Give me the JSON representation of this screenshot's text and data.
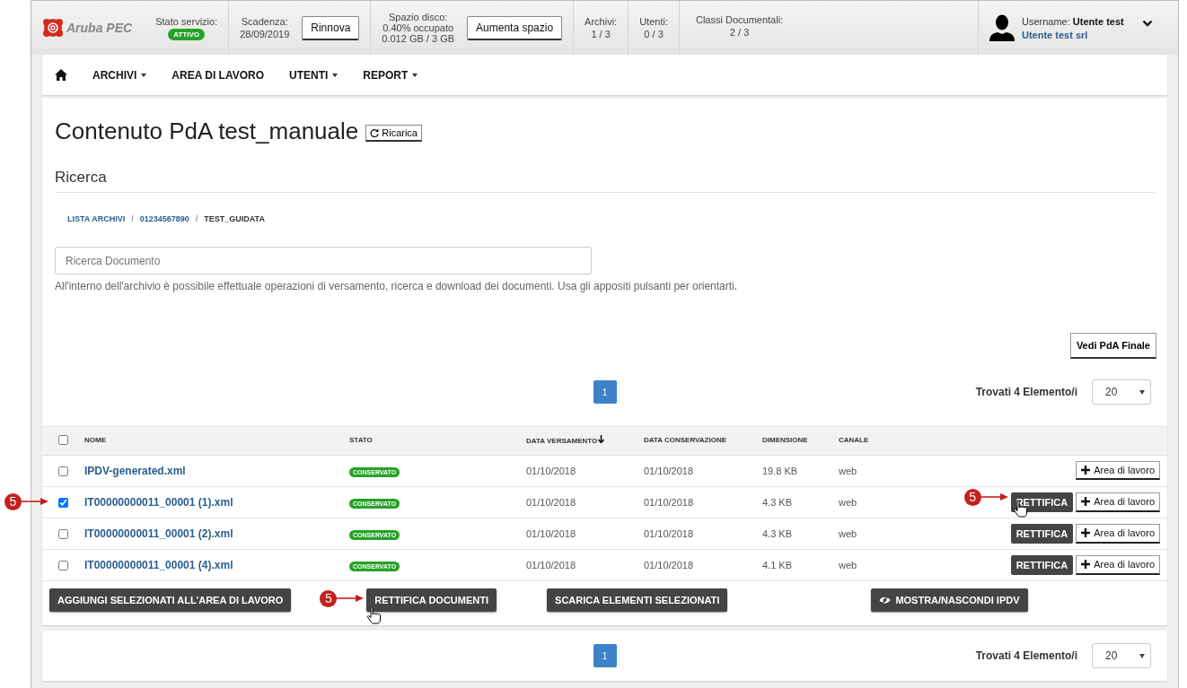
{
  "header": {
    "logo": "Aruba PEC",
    "status": {
      "label": "Stato servizio:",
      "badge": "ATTIVO"
    },
    "expiry": {
      "label": "Scadenza:",
      "value": "28/09/2019",
      "button": "Rinnova"
    },
    "disk": {
      "label": "Spazio disco:",
      "used": "0.40% occupato",
      "value": "0.012 GB / 3 GB",
      "button": "Aumenta spazio"
    },
    "counters": [
      {
        "label": "Archivi:",
        "value": "1 / 3"
      },
      {
        "label": "Utenti:",
        "value": "0 / 3"
      },
      {
        "label": "Classi Documentali:",
        "value": "2 / 3"
      }
    ],
    "user": {
      "label": "Username:",
      "name": "Utente test",
      "company": "Utente test srl"
    }
  },
  "nav": [
    {
      "label": "ARCHIVI",
      "dropdown": true
    },
    {
      "label": "AREA DI LAVORO",
      "dropdown": false
    },
    {
      "label": "UTENTI",
      "dropdown": true
    },
    {
      "label": "REPORT",
      "dropdown": true
    }
  ],
  "title": "Contenuto PdA test_manuale",
  "reload_button": "Ricarica",
  "section": "Ricerca",
  "breadcrumb": [
    {
      "label": "LISTA ARCHIVI",
      "link": true
    },
    {
      "separator": "/",
      "label": "01234567890",
      "link": true
    },
    {
      "separator": "/",
      "label": "TEST_GUIDATA",
      "link": false
    }
  ],
  "search": {
    "placeholder": "Ricerca Documento"
  },
  "help": "All'interno dell'archivio è possibile effettuale operazioni di versamento, ricerca e download dei documenti. Usa gli appositi pulsanti per orientarti.",
  "final_button": "Vedi PdA Finale",
  "pagination_top": {
    "pages": [
      {
        "label": "1",
        "selected": true
      }
    ],
    "found": "Trovati 4 Elemento/i",
    "page_size": "20"
  },
  "table": {
    "select_all_checked": false,
    "columns": [
      {
        "label": "NOME",
        "sorted": false
      },
      {
        "label": "STATO",
        "sorted": false
      },
      {
        "label": "DATA VERSAMENTO",
        "sorted": true
      },
      {
        "label": "DATA CONSERVAZIONE",
        "sorted": false
      },
      {
        "label": "DIMENSIONE",
        "sorted": false
      },
      {
        "label": "CANALE",
        "sorted": false
      }
    ],
    "rows": [
      {
        "checked": false,
        "name": "IPDV-generated.xml",
        "status": "CONSERVATO",
        "date_versamento": "01/10/2018",
        "date_conservazione": "01/10/2018",
        "size": "19.8 KB",
        "channel": "web",
        "add": "Area di lavoro"
      },
      {
        "checked": true,
        "name": "IT00000000011_00001 (1).xml",
        "status": "CONSERVATO",
        "date_versamento": "01/10/2018",
        "date_conservazione": "01/10/2018",
        "size": "4.3 KB",
        "channel": "web",
        "rettifica": "RETTIFICA",
        "add": "Area di lavoro",
        "checkbox_callout": "5",
        "rettifica_callout": "5"
      },
      {
        "checked": false,
        "name": "IT00000000011_00001 (2).xml",
        "status": "CONSERVATO",
        "date_versamento": "01/10/2018",
        "date_conservazione": "01/10/2018",
        "size": "4.3 KB",
        "channel": "web",
        "rettifica": "RETTIFICA",
        "add": "Area di lavoro"
      },
      {
        "checked": false,
        "name": "IT00000000011_00001 (4).xml",
        "status": "CONSERVATO",
        "date_versamento": "01/10/2018",
        "date_conservazione": "01/10/2018",
        "size": "4.1 KB",
        "channel": "web",
        "rettifica": "RETTIFICA",
        "add": "Area di lavoro"
      }
    ]
  },
  "actions": [
    {
      "label": "AGGIUNGI SELEZIONATI ALL'AREA DI LAVORO",
      "kind": "plain"
    },
    {
      "label": "RETTIFICA DOCUMENTI",
      "kind": "plain",
      "callout": "5"
    },
    {
      "label": "SCARICA ELEMENTI SELEZIONATI",
      "kind": "plain"
    },
    {
      "label": "MOSTRA/NASCONDI IPDV",
      "kind": "eye"
    }
  ],
  "pagination_bottom": {
    "pages": [
      {
        "label": "1",
        "selected": true
      }
    ],
    "found": "Trovati 4 Elemento/i",
    "page_size": "20"
  }
}
